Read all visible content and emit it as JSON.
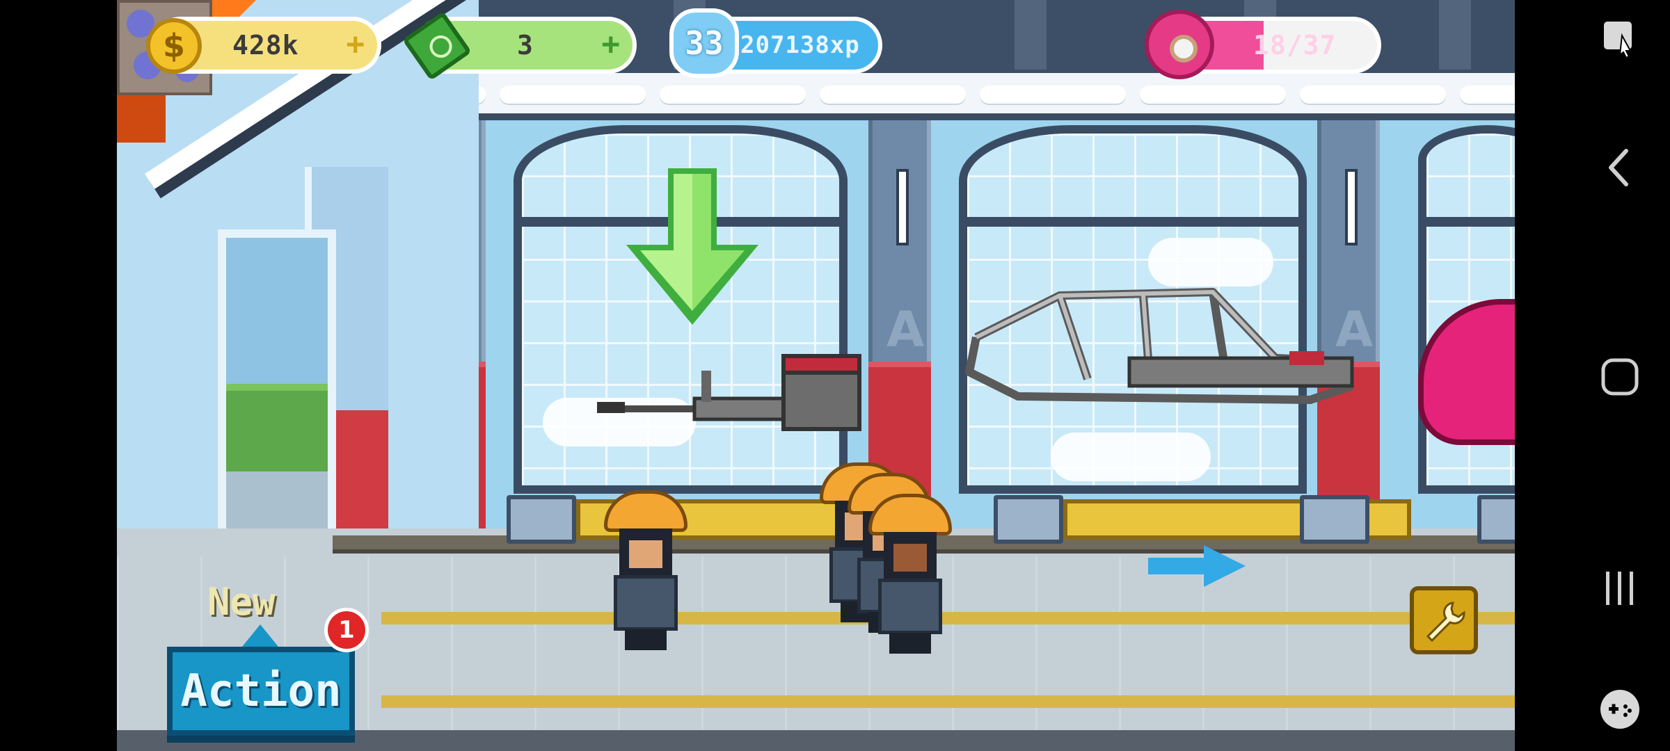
{
  "hud": {
    "coins": {
      "value": "428k",
      "icon": "coin-icon",
      "plus": "+"
    },
    "cash": {
      "value": "3",
      "icon": "cash-icon",
      "plus": "+"
    },
    "xp": {
      "level": "33",
      "value": "207138xp"
    },
    "donuts": {
      "value": "18/37",
      "current": 18,
      "max": 37,
      "fill_fraction": 0.49
    }
  },
  "action": {
    "new_label": "New",
    "label": "Action",
    "badge_count": "1"
  },
  "tools": {
    "wrench": "wrench-icon"
  },
  "navbar": {
    "items": [
      "screenshot-icon",
      "back-icon",
      "home-icon",
      "recents-icon",
      "game-tools-icon"
    ]
  },
  "colors": {
    "coin": "#f3c229",
    "cash": "#3fa83a",
    "xp": "#48b6ee",
    "donut": "#e53a86",
    "action": "#1796c7",
    "badge": "#e02626"
  }
}
